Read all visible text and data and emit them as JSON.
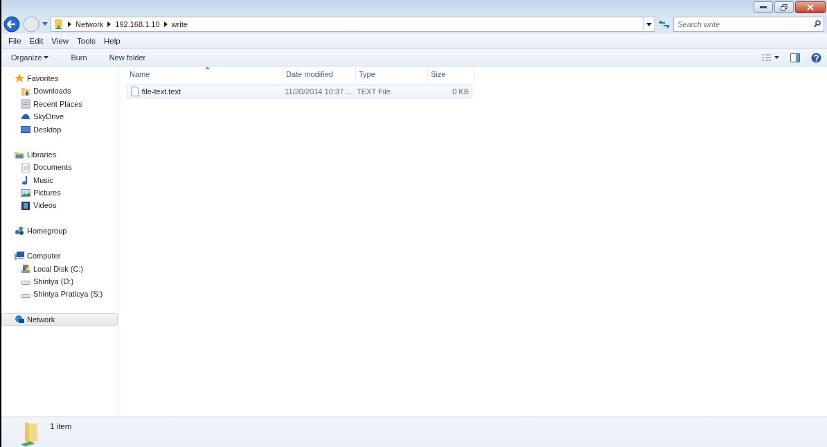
{
  "address_bar": {
    "path": [
      "Network",
      "192.168.1.10",
      "write"
    ]
  },
  "search": {
    "placeholder": "Search write"
  },
  "menu": [
    "File",
    "Edit",
    "View",
    "Tools",
    "Help"
  ],
  "toolbar": [
    {
      "label": "Organize",
      "dropdown": true
    },
    {
      "label": "Burn",
      "dropdown": false
    },
    {
      "label": "New folder",
      "dropdown": false
    }
  ],
  "sidebar": {
    "groups": [
      {
        "label": "Favorites",
        "selected": false,
        "children": [
          {
            "label": "Downloads",
            "selected": false
          },
          {
            "label": "Recent Places",
            "selected": false
          },
          {
            "label": "SkyDrive",
            "selected": false
          },
          {
            "label": "Desktop",
            "selected": false
          }
        ]
      },
      {
        "label": "Libraries",
        "selected": false,
        "children": [
          {
            "label": "Documents",
            "selected": false
          },
          {
            "label": "Music",
            "selected": false
          },
          {
            "label": "Pictures",
            "selected": false
          },
          {
            "label": "Videos",
            "selected": false
          }
        ]
      },
      {
        "label": "Homegroup",
        "selected": false
      },
      {
        "label": "Computer",
        "selected": false,
        "children": [
          {
            "label": "Local Disk (C:)",
            "selected": false
          },
          {
            "label": "Shintya (D:)",
            "selected": false
          },
          {
            "label": "Shintya Praticya (S:)",
            "selected": false
          }
        ]
      },
      {
        "label": "Network",
        "selected": true
      }
    ]
  },
  "table": {
    "columns": [
      {
        "label": "Name",
        "sorted": true
      },
      {
        "label": "Date modified",
        "sorted": false
      },
      {
        "label": "Type",
        "sorted": false
      },
      {
        "label": "Size",
        "sorted": false
      }
    ],
    "rows": [
      {
        "name": "file-text.text",
        "date": "11/30/2014 10:37 ...",
        "type": "TEXT File",
        "size": "0 KB",
        "hovered": true
      }
    ]
  },
  "status_bar": {
    "text": "1 item"
  }
}
